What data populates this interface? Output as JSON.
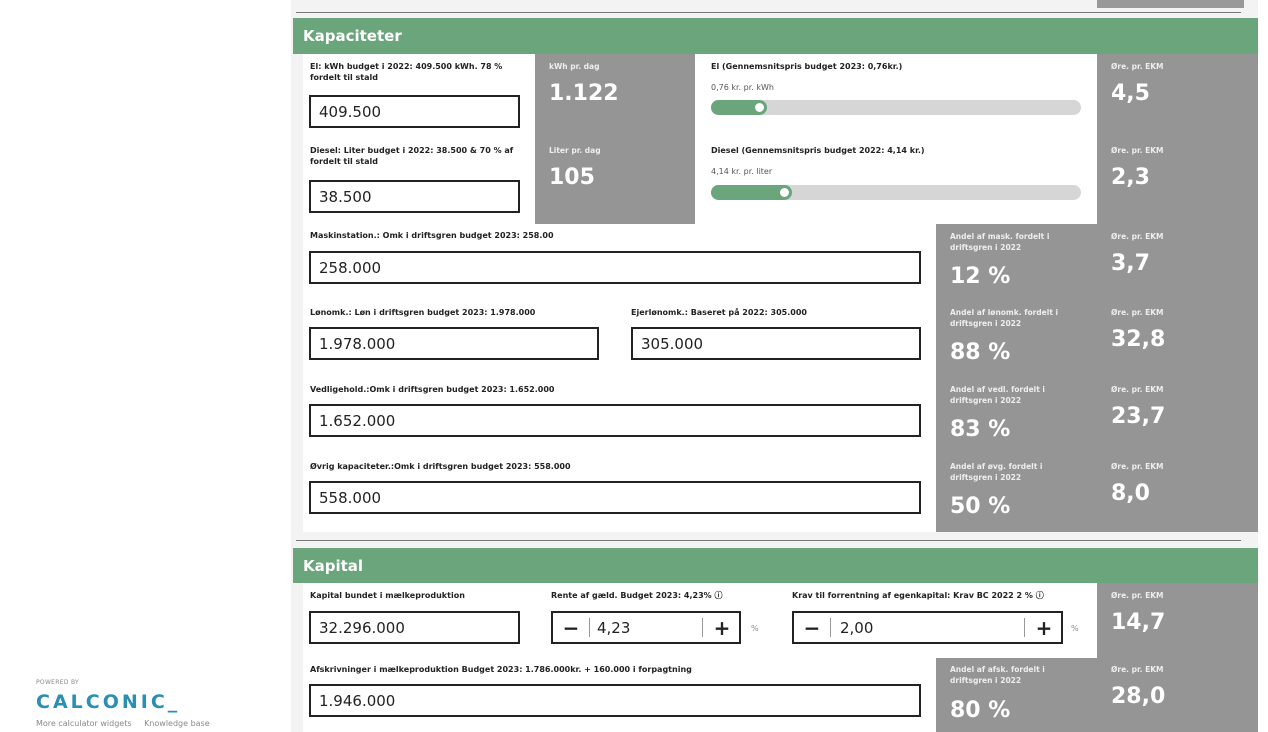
{
  "brand": {
    "powered_by": "POWERED BY",
    "logo": "CALCONIC_",
    "links": [
      "More calculator widgets",
      "Knowledge base"
    ]
  },
  "kapaciteter": {
    "title": "Kapaciteter",
    "el": {
      "label": "El: kWh budget i 2022: 409.500 kWh. 78 % fordelt til stald",
      "value": "409.500",
      "per_day_caption": "kWh pr. dag",
      "per_day_value": "1.122",
      "price_label": "El (Gennemsnitspris budget 2023: 0,76kr.)",
      "price_sub": "0,76 kr. pr. kWh",
      "slider_fraction": 0.15,
      "ore_caption": "Øre. pr. EKM",
      "ore_value": "4,5"
    },
    "diesel": {
      "label": "Diesel: Liter budget i 2022: 38.500 & 70 % af fordelt til stald",
      "value": "38.500",
      "per_day_caption": "Liter pr. dag",
      "per_day_value": "105",
      "price_label": "Diesel (Gennemsnitspris budget 2022: 4,14 kr.)",
      "price_sub": "4,14 kr. pr. liter",
      "slider_fraction": 0.22,
      "ore_caption": "Øre. pr. EKM",
      "ore_value": "2,3"
    },
    "maskin": {
      "label": "Maskinstation.: Omk i driftsgren budget 2023: 258.00",
      "value": "258.000",
      "share_caption": "Andel af mask. fordelt i driftsgren i 2022",
      "share_value": "12 %",
      "ore_caption": "Øre. pr. EKM",
      "ore_value": "3,7"
    },
    "lon": {
      "label": "Lønomk.: Løn i driftsgren budget 2023: 1.978.000",
      "value": "1.978.000",
      "ejer_label": "Ejerlønomk.: Baseret på 2022: 305.000",
      "ejer_value": "305.000",
      "share_caption": "Andel af lønomk. fordelt i driftsgren i 2022",
      "share_value": "88 %",
      "ore_caption": "Øre. pr. EKM",
      "ore_value": "32,8"
    },
    "vedl": {
      "label": "Vedligehold.:Omk i driftsgren budget 2023: 1.652.000",
      "value": "1.652.000",
      "share_caption": "Andel af vedl. fordelt i driftsgren i 2022",
      "share_value": "83 %",
      "ore_caption": "Øre. pr. EKM",
      "ore_value": "23,7"
    },
    "ovrig": {
      "label": "Øvrig kapaciteter.:Omk i driftsgren budget 2023: 558.000",
      "value": "558.000",
      "share_caption": "Andel af øvg. fordelt i driftsgren i 2022",
      "share_value": "50 %",
      "ore_caption": "Øre. pr. EKM",
      "ore_value": "8,0"
    }
  },
  "kapital": {
    "title": "Kapital",
    "bundet_label": "Kapital bundet i mælkeproduktion",
    "bundet_value": "32.296.000",
    "rente_label": "Rente af gæld. Budget 2023: 4,23%",
    "rente_value": "4,23",
    "krav_label": "Krav til forrentning af egenkapital: Krav BC 2022 2 %",
    "krav_value": "2,00",
    "unit": "%",
    "info_icon": "ⓘ",
    "minus": "−",
    "plus": "+",
    "ore_caption": "Øre. pr. EKM",
    "ore_value": "14,7",
    "afskr_label": "Afskrivninger i mælkeproduktion Budget 2023: 1.786.000kr. + 160.000 i forpagtning",
    "afskr_value": "1.946.000",
    "afskr_share_caption": "Andel af afsk. fordelt i driftsgren i 2022",
    "afskr_share_value": "80 %",
    "afskr_ore_caption": "Øre. pr. EKM",
    "afskr_ore_value": "28,0"
  },
  "colors": {
    "accent": "#6aa57b",
    "panel": "#959595",
    "brand": "#2a8fb4"
  }
}
